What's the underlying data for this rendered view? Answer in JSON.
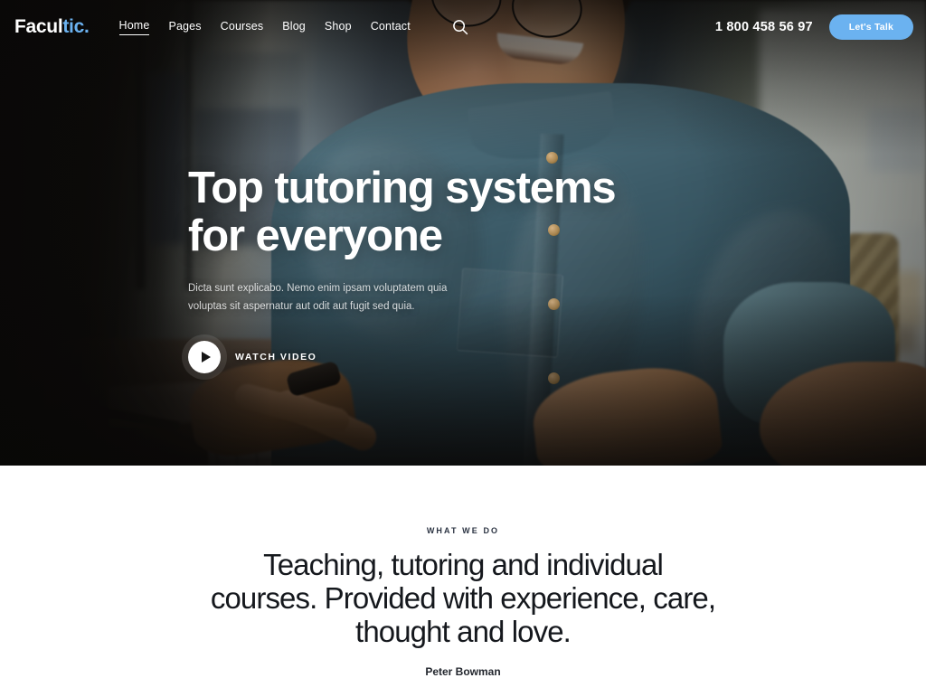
{
  "header": {
    "logo": {
      "primary": "Facul",
      "accent": "tic.",
      "accent_color": "#6bb2f0"
    },
    "nav": [
      {
        "label": "Home",
        "active": true
      },
      {
        "label": "Pages",
        "active": false
      },
      {
        "label": "Courses",
        "active": false
      },
      {
        "label": "Blog",
        "active": false
      },
      {
        "label": "Shop",
        "active": false
      },
      {
        "label": "Contact",
        "active": false
      }
    ],
    "search_icon": "search-icon",
    "phone": "1 800 458 56 97",
    "cta_label": "Let's Talk",
    "cta_color": "#6bb2f0"
  },
  "hero": {
    "title": "Top tutoring systems\nfor everyone",
    "subtitle": "Dicta sunt explicabo. Nemo enim ipsam voluptatem quia voluptas sit aspernatur aut odit aut fugit sed quia.",
    "watch_label": "WATCH VIDEO",
    "play_icon": "play-icon",
    "background_description": "Smiling man with round eyeglasses in a denim shirt typing on a laptop keyboard at a wooden desk"
  },
  "what_we_do": {
    "eyebrow": "WHAT WE DO",
    "title": "Teaching, tutoring and individual\ncourses. Provided with experience, care,\nthought and love.",
    "author": "Peter Bowman"
  }
}
